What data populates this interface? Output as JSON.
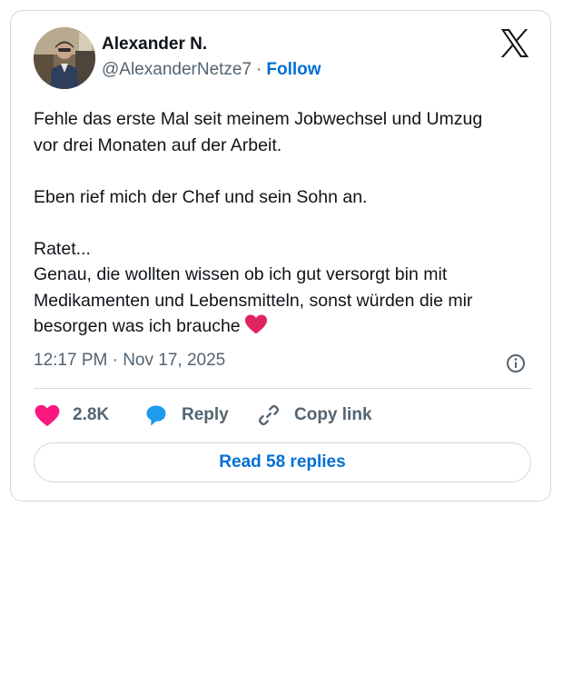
{
  "author": {
    "display_name": "Alexander N.",
    "handle": "@AlexanderNetze7",
    "separator": "·",
    "follow_label": "Follow"
  },
  "tweet": {
    "lines": [
      "Fehle das erste Mal seit meinem Jobwechsel und Umzug",
      "vor drei Monaten auf der Arbeit.",
      "",
      "Eben rief mich der Chef und sein Sohn an.",
      "",
      "Ratet...",
      "Genau, die wollten wissen ob ich gut versorgt bin mit",
      "Medikamenten und Lebensmitteln, sonst würden die mir",
      "besorgen was ich brauche"
    ],
    "trailing_emoji": "red-heart-emoji",
    "timestamp": "12:17 PM · Nov 17, 2025"
  },
  "actions": {
    "like_count": "2.8K",
    "reply_label": "Reply",
    "copy_link_label": "Copy link"
  },
  "read_replies_label": "Read 58 replies",
  "icons": {
    "brand": "x-logo-icon",
    "like": "heart-icon",
    "reply": "speech-bubble-icon",
    "copy": "link-icon",
    "info": "info-icon"
  },
  "colors": {
    "like": "#f91880",
    "reply": "#1d9bf0",
    "link": "#006fd6",
    "secondary_text": "#536471",
    "border": "#cfd9de",
    "emoji_heart": "#e0245e"
  }
}
